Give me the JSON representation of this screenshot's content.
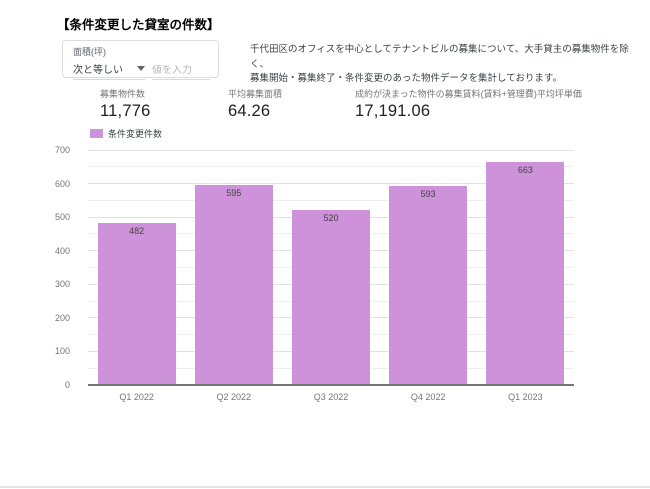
{
  "page": {
    "title": "【条件変更した貸室の件数】"
  },
  "filter": {
    "label": "面積(坪)",
    "operator": "次と等しい",
    "dropdown_icon": "caret-down",
    "input_value": "",
    "input_placeholder": "値を入力"
  },
  "description": {
    "line1": "千代田区のオフィスを中心としてテナントビルの募集について、大手貸主の募集物件を除く、",
    "line2": "募集開始・募集終了・条件変更のあった物件データを集計しております。"
  },
  "kpis": [
    {
      "label": "募集物件数",
      "value": "11,776"
    },
    {
      "label": "平均募集面積",
      "value": "64.26"
    },
    {
      "label": "成約が決まった物件の募集賃料(賃料+管理費)平均坪単価",
      "value": "17,191.06"
    }
  ],
  "legend": {
    "label": "条件変更件数",
    "swatch_color": "#cd92d9"
  },
  "chart_data": {
    "type": "bar",
    "title": "条件変更した貸室の件数",
    "categories": [
      "Q1 2022",
      "Q2 2022",
      "Q3 2022",
      "Q4 2022",
      "Q1 2023"
    ],
    "values": [
      482,
      595,
      520,
      593,
      663
    ],
    "series_name": "条件変更件数",
    "xlabel": "",
    "ylabel": "",
    "ylim": [
      0,
      700
    ],
    "y_tick_interval": 100,
    "y_minor_interval": 50,
    "grid": true,
    "bar_color": "#cd92d9",
    "value_label_color": "#424242",
    "legend_position": "top-left"
  },
  "colors": {
    "accent_purple": "#cd92d9",
    "axis_line": "#757575",
    "grid_major": "#e2e2e2",
    "grid_minor": "#efefef",
    "tick_text": "#757575"
  }
}
